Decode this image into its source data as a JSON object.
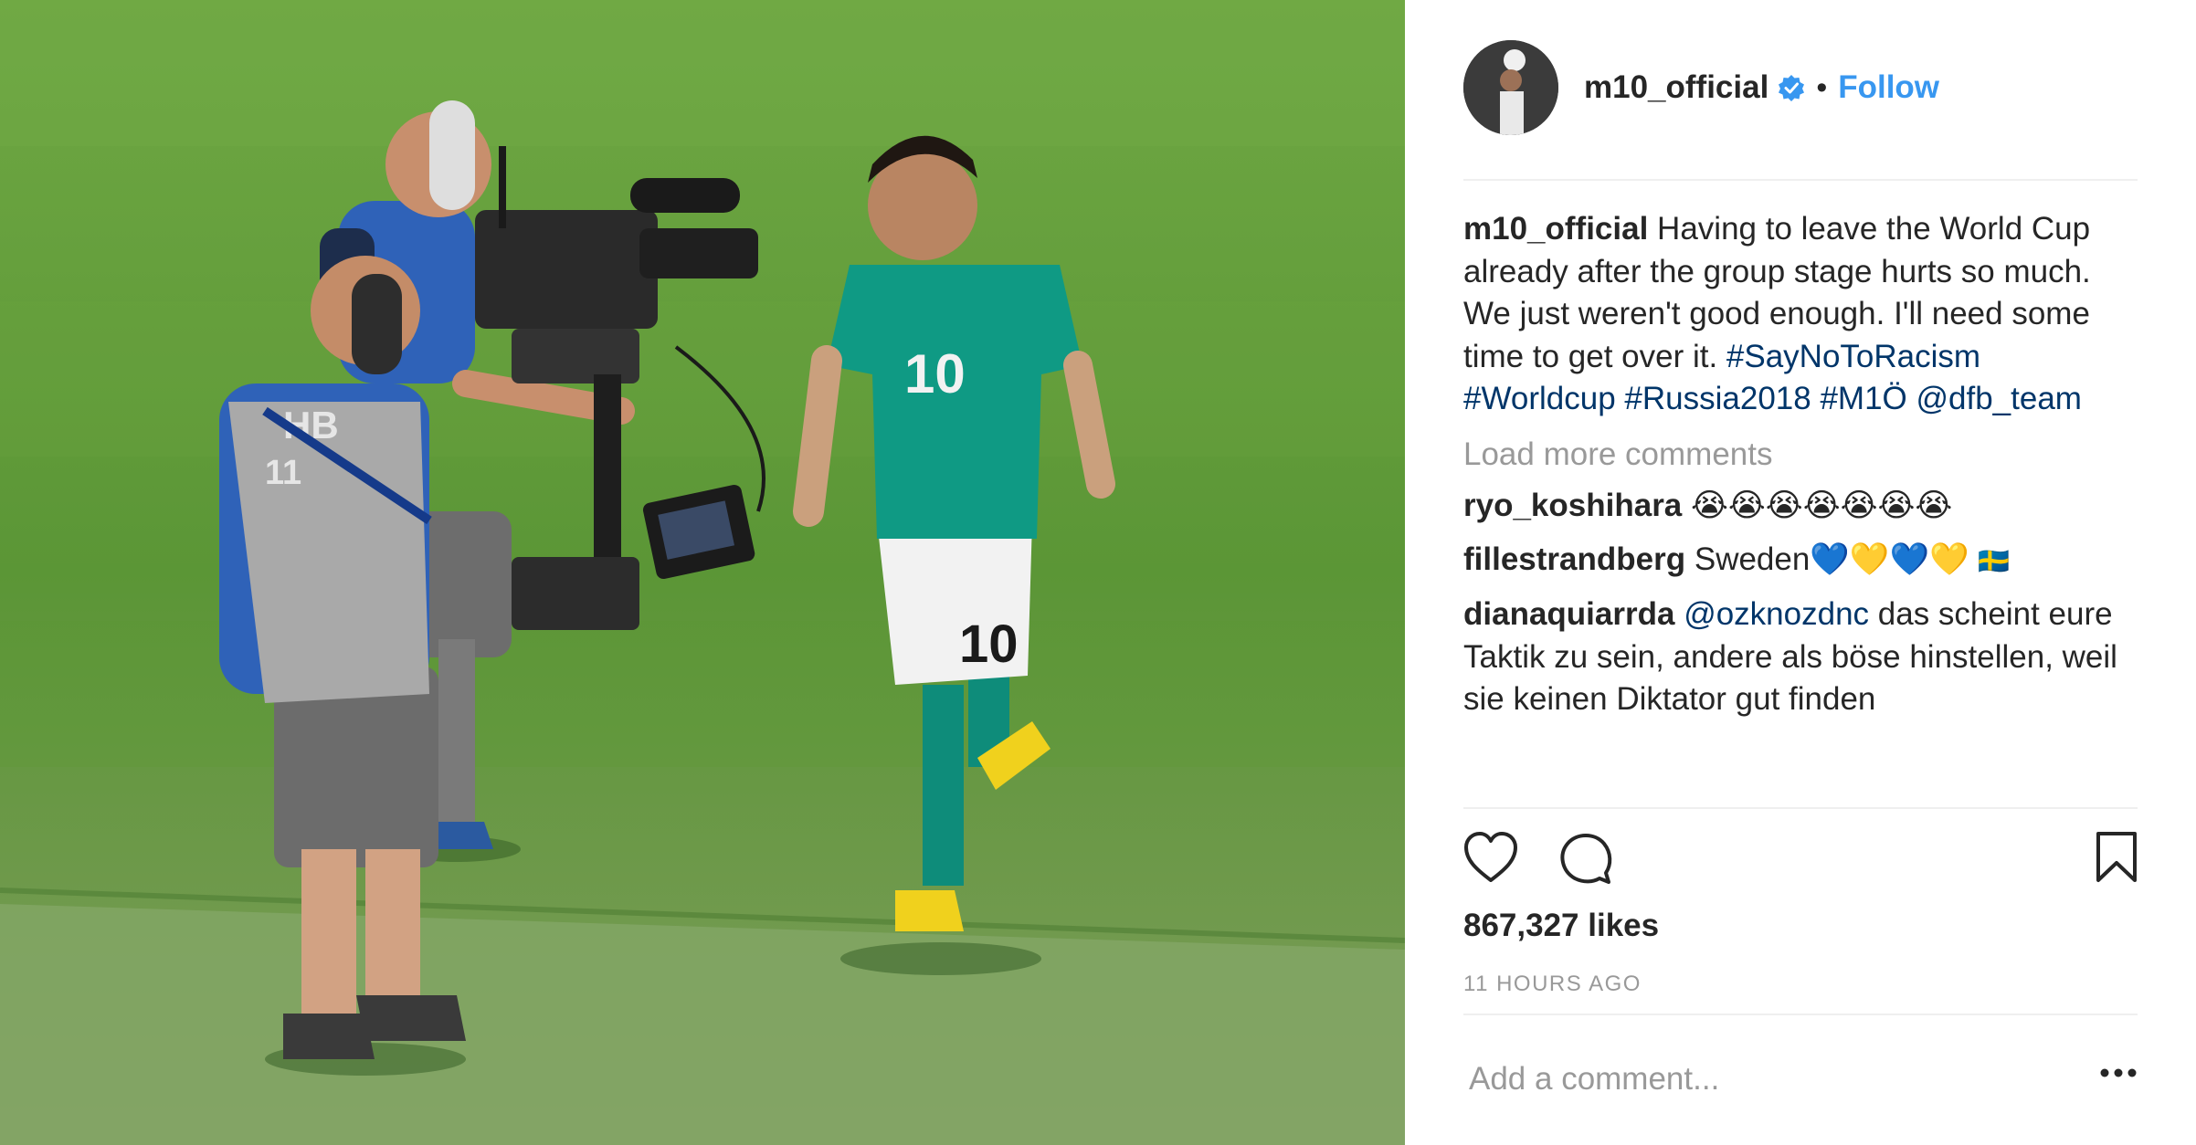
{
  "post": {
    "username": "m10_official",
    "follow_label": "Follow",
    "separator": "•",
    "caption": {
      "text": "Having to leave the World Cup already after the group stage hurts so much. We just weren't good enough. I'll need some time to get over it.",
      "hashtags": [
        "#SayNoToRacism",
        "#Worldcup",
        "#Russia2018",
        "#M1Ö"
      ],
      "mention": "@dfb_team"
    },
    "load_more_label": "Load more comments",
    "comments": [
      {
        "user": "ryo_koshihara",
        "text": "😭😭😭😭😭😭😭"
      },
      {
        "user": "fillestrandberg",
        "text": "Sweden💙💛💙💛",
        "flag": "🇸🇪"
      },
      {
        "user": "dianaquiarrda",
        "mention": "@ozknozdnc",
        "text": "das scheint eure Taktik zu sein, andere als böse hinstellen, weil sie keinen Diktator gut finden"
      }
    ],
    "likes": "867,327 likes",
    "time_ago": "11 HOURS AGO",
    "add_comment_placeholder": "Add a comment...",
    "icons": {
      "like": "heart-icon",
      "comment": "speech-bubble-icon",
      "save": "bookmark-icon",
      "more": "more-options-icon",
      "verified": "verified-badge-icon"
    },
    "colors": {
      "accent": "#3897f0",
      "hashtag": "#003569",
      "muted": "#999999",
      "text": "#262626",
      "grass": "#5f9a3a"
    }
  }
}
